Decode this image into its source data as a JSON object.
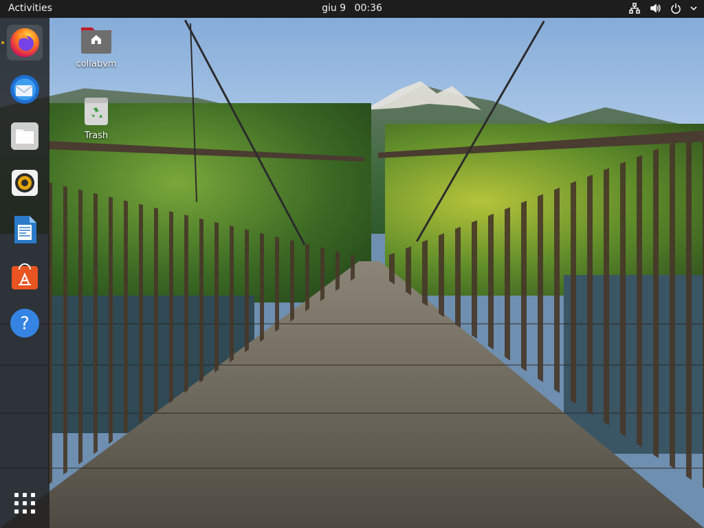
{
  "topbar": {
    "activities_label": "Activities",
    "date": "giu 9",
    "time": "00:36",
    "tray_icons": [
      "network-icon",
      "volume-icon",
      "power-icon",
      "menu-chevron-icon"
    ]
  },
  "dock": {
    "items": [
      {
        "name": "firefox",
        "icon": "firefox-icon"
      },
      {
        "name": "thunderbird",
        "icon": "thunderbird-icon"
      },
      {
        "name": "files",
        "icon": "files-icon"
      },
      {
        "name": "rhythmbox",
        "icon": "rhythmbox-icon"
      },
      {
        "name": "libreoffice-writer",
        "icon": "writer-icon"
      },
      {
        "name": "ubuntu-software",
        "icon": "software-store-icon"
      },
      {
        "name": "help",
        "icon": "help-icon"
      }
    ],
    "show_apps_icon": "app-grid-icon"
  },
  "desktop": {
    "icons": [
      {
        "label": "collabvm",
        "icon": "home-folder-icon"
      },
      {
        "label": "Trash",
        "icon": "trash-icon"
      }
    ]
  },
  "colors": {
    "topbar_bg": "#1d1d1d",
    "dock_bg": "#1e1e1e",
    "accent_orange": "#e95420"
  }
}
